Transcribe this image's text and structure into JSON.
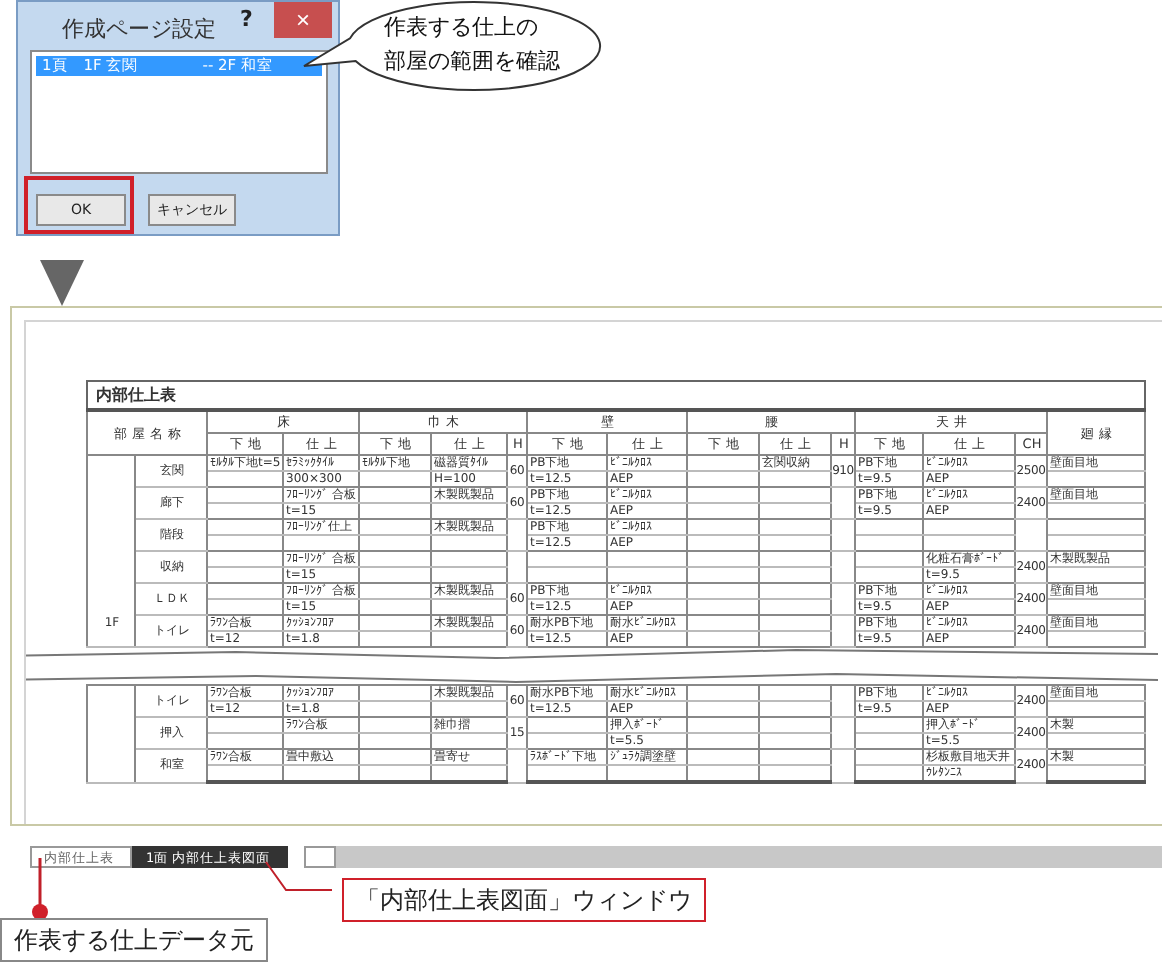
{
  "dialog": {
    "title": "作成ページ設定",
    "help": "?",
    "close": "×",
    "list_items": [
      {
        "text": "1頁　1F 玄関　　　　-- 2F 和室",
        "selected": true
      }
    ],
    "buttons": [
      {
        "label": "OK",
        "highlighted": true
      },
      {
        "label": "キャンセル",
        "highlighted": false
      }
    ]
  },
  "callout": {
    "lines": [
      "作表する仕上の",
      "部屋の範囲を確認"
    ]
  },
  "document": {
    "title": "内部仕上表",
    "room_header": "部 屋 名 称",
    "header_groups": [
      {
        "label": "床",
        "columns": [
          "下 地",
          "仕 上"
        ]
      },
      {
        "label": "巾 木",
        "columns": [
          "下 地",
          "仕 上",
          "H"
        ]
      },
      {
        "label": "壁",
        "columns": [
          "下 地",
          "仕 上"
        ]
      },
      {
        "label": "腰",
        "columns": [
          "下 地",
          "仕 上",
          "H"
        ]
      },
      {
        "label": "天 井",
        "columns": [
          "下 地",
          "仕 上",
          "CH"
        ]
      },
      {
        "label": "廻 縁"
      }
    ],
    "upper_part": {
      "floor": "1F",
      "rows": [
        {
          "room": "玄関",
          "cells": [
            [
              "ﾓﾙﾀﾙ下地t=5"
            ],
            [
              "ｾﾗﾐｯｸﾀｲﾙ",
              "300×300"
            ],
            [
              "ﾓﾙﾀﾙ下地"
            ],
            [
              "磁器質ﾀｲﾙ",
              "H=100"
            ],
            [
              "60"
            ],
            [
              "PB下地",
              "t=12.5"
            ],
            [
              "ﾋﾞﾆﾙｸﾛｽ",
              "AEP"
            ],
            null,
            [
              "玄関収納"
            ],
            [
              "910"
            ],
            [
              "PB下地",
              "t=9.5"
            ],
            [
              "ﾋﾞﾆﾙｸﾛｽ",
              "AEP"
            ],
            [
              "2500"
            ],
            [
              "壁面目地"
            ]
          ]
        },
        {
          "room": "廊下",
          "cells": [
            null,
            [
              "ﾌﾛｰﾘﾝｸﾞ 合板",
              "t=15"
            ],
            null,
            [
              "木製既製品"
            ],
            [
              "60"
            ],
            [
              "PB下地",
              "t=12.5"
            ],
            [
              "ﾋﾞﾆﾙｸﾛｽ",
              "AEP"
            ],
            null,
            null,
            null,
            [
              "PB下地",
              "t=9.5"
            ],
            [
              "ﾋﾞﾆﾙｸﾛｽ",
              "AEP"
            ],
            [
              "2400"
            ],
            [
              "壁面目地"
            ]
          ]
        },
        {
          "room": "階段",
          "cells": [
            null,
            [
              "ﾌﾛｰﾘﾝｸﾞ仕上"
            ],
            null,
            [
              "木製既製品"
            ],
            null,
            [
              "PB下地",
              "t=12.5"
            ],
            [
              "ﾋﾞﾆﾙｸﾛｽ",
              "AEP"
            ],
            null,
            null,
            null,
            null,
            null,
            null,
            null
          ]
        },
        {
          "room": "収納",
          "cells": [
            null,
            [
              "ﾌﾛｰﾘﾝｸﾞ 合板",
              "t=15"
            ],
            null,
            null,
            null,
            null,
            null,
            null,
            null,
            null,
            null,
            [
              "化粧石膏ﾎﾞｰﾄﾞ",
              "t=9.5"
            ],
            [
              "2400"
            ],
            [
              "木製既製品"
            ]
          ]
        },
        {
          "room": "ＬＤＫ",
          "cells": [
            null,
            [
              "ﾌﾛｰﾘﾝｸﾞ 合板",
              "t=15"
            ],
            null,
            [
              "木製既製品"
            ],
            [
              "60"
            ],
            [
              "PB下地",
              "t=12.5"
            ],
            [
              "ﾋﾞﾆﾙｸﾛｽ",
              "AEP"
            ],
            null,
            null,
            null,
            [
              "PB下地",
              "t=9.5"
            ],
            [
              "ﾋﾞﾆﾙｸﾛｽ",
              "AEP"
            ],
            [
              "2400"
            ],
            [
              "壁面目地"
            ]
          ]
        },
        {
          "room": "トイレ",
          "cells": [
            [
              "ﾗﾜﾝ合板",
              "t=12"
            ],
            [
              "ｸｯｼｮﾝﾌﾛｱ",
              "t=1.8"
            ],
            null,
            [
              "木製既製品"
            ],
            [
              "60"
            ],
            [
              "耐水PB下地",
              "t=12.5"
            ],
            [
              "耐水ﾋﾞﾆﾙｸﾛｽ",
              "AEP"
            ],
            null,
            null,
            null,
            [
              "PB下地",
              "t=9.5"
            ],
            [
              "ﾋﾞﾆﾙｸﾛｽ",
              "AEP"
            ],
            [
              "2400"
            ],
            [
              "壁面目地"
            ]
          ]
        }
      ]
    },
    "lower_part": {
      "rows": [
        {
          "room": "トイレ",
          "cells": [
            [
              "ﾗﾜﾝ合板",
              "t=12"
            ],
            [
              "ｸｯｼｮﾝﾌﾛｱ",
              "t=1.8"
            ],
            null,
            [
              "木製既製品"
            ],
            [
              "60"
            ],
            [
              "耐水PB下地",
              "t=12.5"
            ],
            [
              "耐水ﾋﾞﾆﾙｸﾛｽ",
              "AEP"
            ],
            null,
            null,
            null,
            [
              "PB下地",
              "t=9.5"
            ],
            [
              "ﾋﾞﾆﾙｸﾛｽ",
              "AEP"
            ],
            [
              "2400"
            ],
            [
              "壁面目地"
            ]
          ]
        },
        {
          "room": "押入",
          "cells": [
            null,
            [
              "ﾗﾜﾝ合板"
            ],
            null,
            [
              "雑巾摺"
            ],
            [
              "15"
            ],
            null,
            [
              "押入ﾎﾞｰﾄﾞ",
              "t=5.5"
            ],
            null,
            null,
            null,
            null,
            [
              "押入ﾎﾞｰﾄﾞ",
              "t=5.5"
            ],
            [
              "2400"
            ],
            [
              "木製"
            ]
          ]
        },
        {
          "room": "和室",
          "cells": [
            [
              "ﾗﾜﾝ合板"
            ],
            [
              "畳中敷込"
            ],
            null,
            [
              "畳寄せ"
            ],
            null,
            [
              "ﾗｽﾎﾞｰﾄﾞ下地"
            ],
            [
              "ｼﾞｭﾗｸ調塗壁"
            ],
            null,
            null,
            null,
            null,
            [
              "杉板敷目地天井",
              "ｳﾚﾀﾝﾆｽ"
            ],
            [
              "2400"
            ],
            [
              "木製"
            ]
          ]
        }
      ]
    }
  },
  "sheet_tabs": [
    {
      "kind": "text",
      "label": "内部仕上表",
      "selected": false
    },
    {
      "kind": "text",
      "label": "1面 内部仕上表図面",
      "selected": true
    },
    {
      "kind": "icon",
      "selected": false
    }
  ],
  "notes": [
    {
      "text": "作表する仕上データ元"
    },
    {
      "text": "「内部仕上表図面」ウィンドウ"
    }
  ]
}
